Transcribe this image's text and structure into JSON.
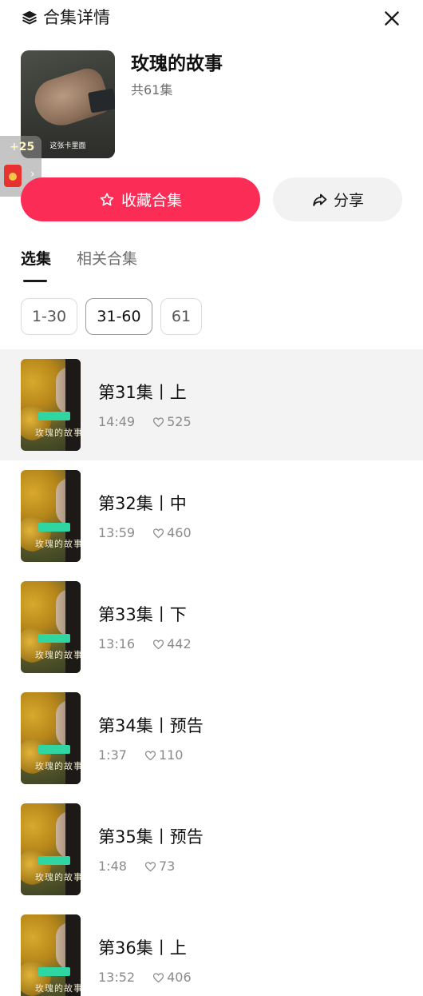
{
  "header": {
    "title": "合集详情",
    "icon": "layers-icon",
    "close_icon": "close-icon"
  },
  "collection": {
    "name": "玫瑰的故事",
    "episode_count": "共61集",
    "cover_caption": "这张卡里面"
  },
  "reward": {
    "points": "+25",
    "icon": "red-envelope-icon"
  },
  "actions": {
    "collect_label": "收藏合集",
    "share_label": "分享"
  },
  "tabs": [
    {
      "label": "选集",
      "active": true
    },
    {
      "label": "相关合集",
      "active": false
    }
  ],
  "ranges": [
    {
      "label": "1-30",
      "selected": false
    },
    {
      "label": "31-60",
      "selected": true
    },
    {
      "label": "61",
      "selected": false
    }
  ],
  "episodes": [
    {
      "title": "第31集丨上",
      "duration": "14:49",
      "likes": "525",
      "current": true,
      "series_name": "玫瑰的故事"
    },
    {
      "title": "第32集丨中",
      "duration": "13:59",
      "likes": "460",
      "current": false,
      "series_name": "玫瑰的故事"
    },
    {
      "title": "第33集丨下",
      "duration": "13:16",
      "likes": "442",
      "current": false,
      "series_name": "玫瑰的故事"
    },
    {
      "title": "第34集丨预告",
      "duration": "1:37",
      "likes": "110",
      "current": false,
      "series_name": "玫瑰的故事"
    },
    {
      "title": "第35集丨预告",
      "duration": "1:48",
      "likes": "73",
      "current": false,
      "series_name": "玫瑰的故事"
    },
    {
      "title": "第36集丨上",
      "duration": "13:52",
      "likes": "406",
      "current": false,
      "series_name": "玫瑰的故事"
    }
  ],
  "colors": {
    "accent": "#fb2c55",
    "highlight_row": "#f3f3f3",
    "muted_text": "#8a8a8a"
  }
}
